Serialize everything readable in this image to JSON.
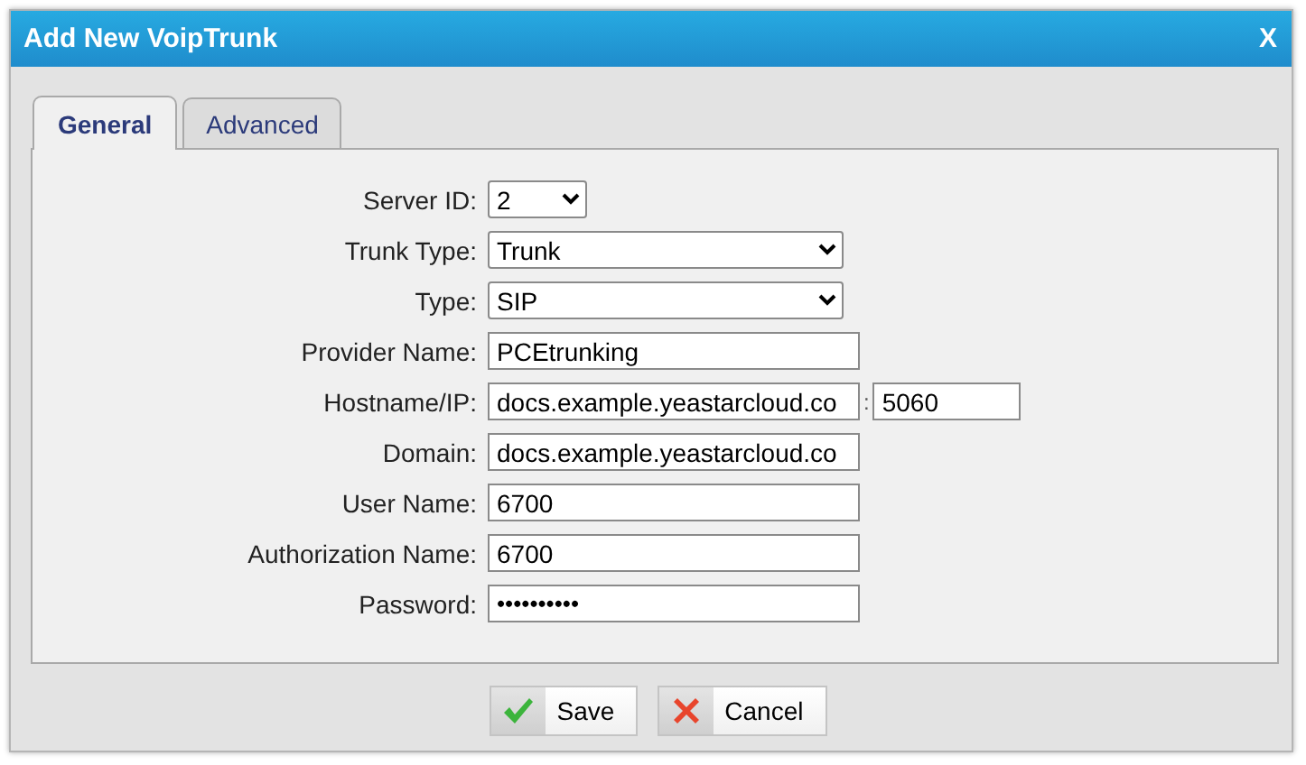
{
  "window": {
    "title": "Add New VoipTrunk",
    "close": "X"
  },
  "tabs": [
    {
      "label": "General",
      "selected": true
    },
    {
      "label": "Advanced",
      "selected": false
    }
  ],
  "fields": [
    {
      "label": "Server ID:",
      "kind": "short_select",
      "value": "2"
    },
    {
      "label": "Trunk Type:",
      "kind": "select",
      "value": "Trunk"
    },
    {
      "label": "Type:",
      "kind": "select",
      "value": "SIP"
    },
    {
      "label": "Provider Name:",
      "kind": "text",
      "value": "PCEtrunking"
    },
    {
      "label": "Hostname/IP:",
      "kind": "host",
      "value": "docs.example.yeastarcloud.co",
      "separator": ":",
      "port": "5060"
    },
    {
      "label": "Domain:",
      "kind": "text",
      "value": "docs.example.yeastarcloud.co"
    },
    {
      "label": "User Name:",
      "kind": "text",
      "value": "6700"
    },
    {
      "label": "Authorization Name:",
      "kind": "text",
      "value": "6700"
    },
    {
      "label": "Password:",
      "kind": "password",
      "value": "••••••••••"
    }
  ],
  "buttons": [
    {
      "label": "Save",
      "kind": "save"
    },
    {
      "label": "Cancel",
      "kind": "cancel"
    }
  ]
}
